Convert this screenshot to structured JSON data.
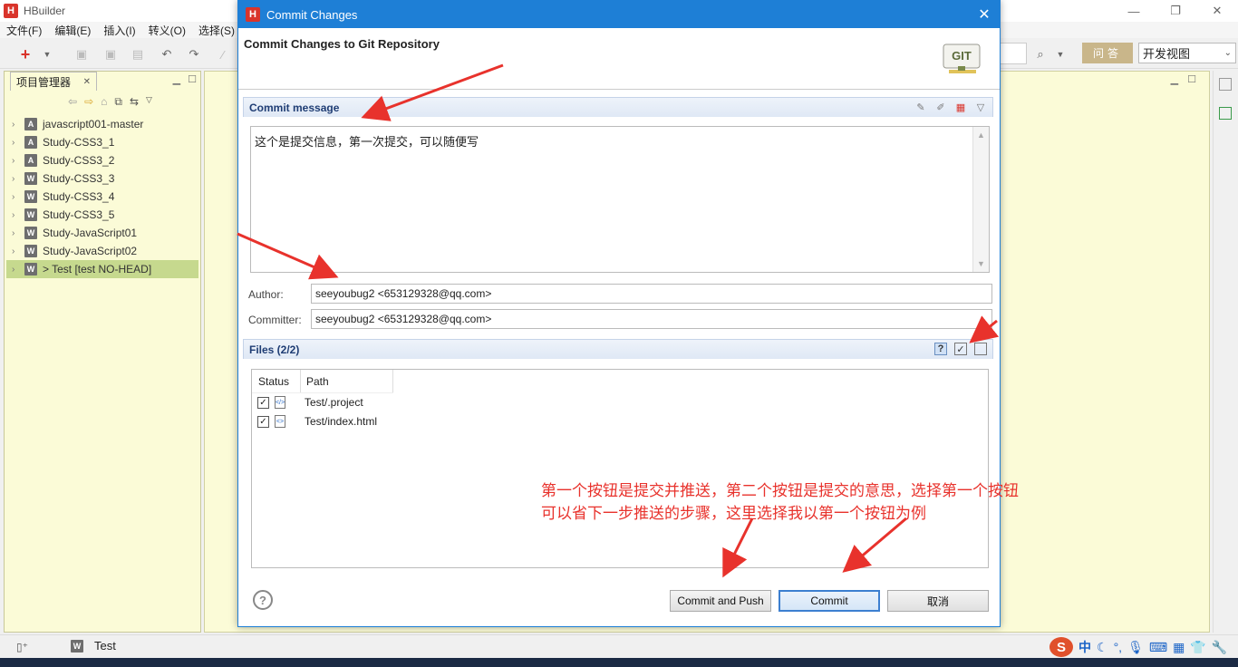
{
  "app": {
    "title": "HBuilder",
    "menu": [
      "文件(F)",
      "编辑(E)",
      "插入(I)",
      "转义(O)",
      "选择(S)"
    ],
    "ask_label": "问答",
    "view_label": "开发视图"
  },
  "project_panel": {
    "tab_label": "项目管理器",
    "items": [
      {
        "name": "javascript001-master",
        "type": "A"
      },
      {
        "name": "Study-CSS3_1",
        "type": "A"
      },
      {
        "name": "Study-CSS3_2",
        "type": "A"
      },
      {
        "name": "Study-CSS3_3",
        "type": "W"
      },
      {
        "name": "Study-CSS3_4",
        "type": "W"
      },
      {
        "name": "Study-CSS3_5",
        "type": "W"
      },
      {
        "name": "Study-JavaScript01",
        "type": "W"
      },
      {
        "name": "Study-JavaScript02",
        "type": "W"
      },
      {
        "name": "> Test [test NO-HEAD]",
        "type": "W"
      }
    ]
  },
  "statusbar": {
    "project_label": "Test",
    "tray_ime": "中"
  },
  "dialog": {
    "title": "Commit Changes",
    "heading": "Commit Changes to Git Repository",
    "git_logo_text": "GIT",
    "commit_section": "Commit message",
    "commit_message": "这个是提交信息，第一次提交，可以随便写",
    "author_label": "Author:",
    "author_value": "seeyoubug2 <653129328@qq.com>",
    "committer_label": "Committer:",
    "committer_value": "seeyoubug2 <653129328@qq.com>",
    "files_section": "Files (2/2)",
    "col_status": "Status",
    "col_path": "Path",
    "files": [
      {
        "path": "Test/.project",
        "checked": true
      },
      {
        "path": "Test/index.html",
        "checked": true
      }
    ],
    "annotation_line1": "第一个按钮是提交并推送，第二个按钮是提交的意思，选择第一个按钮",
    "annotation_line2": "可以省下一步推送的步骤，这里选择我以第一个按钮为例",
    "btn_commit_push": "Commit and Push",
    "btn_commit": "Commit",
    "btn_cancel": "取消"
  },
  "colors": {
    "dialog_title_bg": "#1e7fd6",
    "panel_bg": "#fbfbd7",
    "annotation": "#e8322c"
  }
}
